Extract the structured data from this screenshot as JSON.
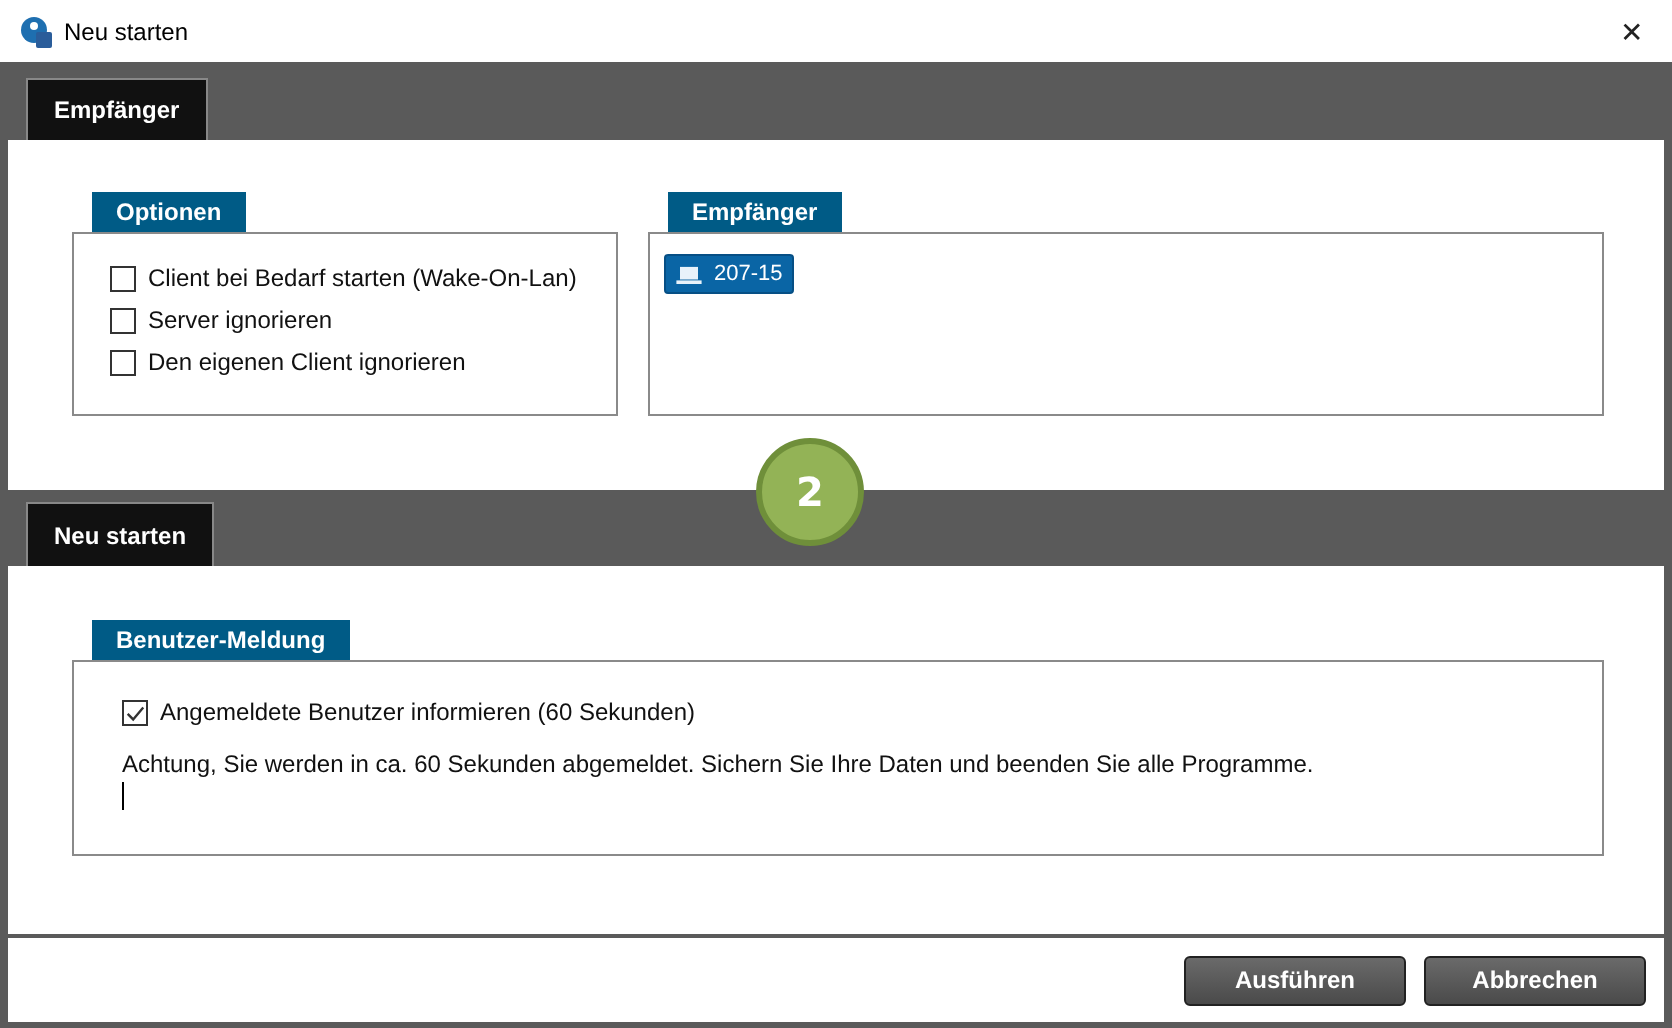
{
  "window": {
    "title": "Neu starten",
    "close": "✕"
  },
  "sections": [
    {
      "tab": "Empfänger",
      "groups": [
        {
          "kind": "options",
          "legend": "Optionen",
          "options": [
            {
              "label": "Client bei Bedarf starten (Wake-On-Lan)",
              "checked": false
            },
            {
              "label": "Server ignorieren",
              "checked": false
            },
            {
              "label": "Den eigenen Client ignorieren",
              "checked": false
            }
          ]
        },
        {
          "kind": "recipients",
          "legend": "Empfänger",
          "recipients": [
            "207-15"
          ]
        }
      ]
    },
    {
      "tab": "Neu starten",
      "groups": [
        {
          "kind": "message",
          "legend": "Benutzer-Meldung",
          "options": [
            {
              "label": "Angemeldete Benutzer informieren (60 Sekunden)",
              "checked": true
            }
          ],
          "message": "Achtung, Sie werden in ca. 60 Sekunden abgemeldet. Sichern Sie Ihre Daten und beenden Sie alle Programme."
        }
      ]
    }
  ],
  "step_badge": "2",
  "buttons": [
    "Ausführen",
    "Abbrechen"
  ]
}
